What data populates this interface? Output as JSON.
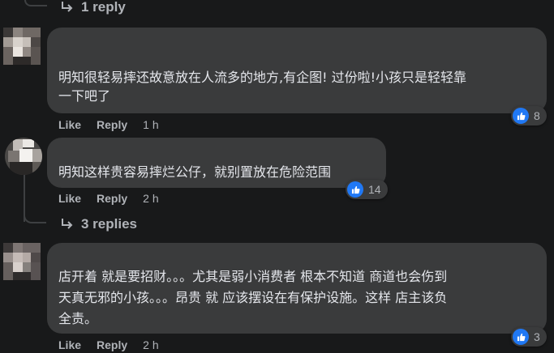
{
  "top_thread": {
    "replies_label": "1 reply",
    "arrow_icon": "reply-arrow-icon"
  },
  "comments": [
    {
      "text_lines": [
        "明知很轻易摔还故意放在人流多的地方,有企图! 过份啦!小孩只是轻轻靠",
        "一下吧了"
      ],
      "like_label": "Like",
      "reply_label": "Reply",
      "time": "1 h",
      "reaction_icon": "thumbs-up-icon",
      "reaction_count": "8"
    },
    {
      "text_lines": [
        "明知这样贵容易摔烂公仔，就别置放在危险范围"
      ],
      "like_label": "Like",
      "reply_label": "Reply",
      "time": "2 h",
      "reaction_icon": "thumbs-up-icon",
      "reaction_count": "14",
      "replies_label": "3 replies"
    },
    {
      "text_lines": [
        "店开着 就是要招财。。。尤其是弱小消费者 根本不知道 商道也会伤到",
        "天真无邪的小孩。。。昂贵 就 应该摆设在有保护设施。这样 店主该负",
        "全责。"
      ],
      "like_label": "Like",
      "reply_label": "Reply",
      "time": "2 h",
      "reaction_icon": "thumbs-up-icon",
      "reaction_count": "3"
    }
  ],
  "colors": {
    "background": "#18191a",
    "bubble": "#3a3b3c",
    "text": "#e4e6eb",
    "meta": "#b0b3b8",
    "like_blue": "#2078f4"
  }
}
